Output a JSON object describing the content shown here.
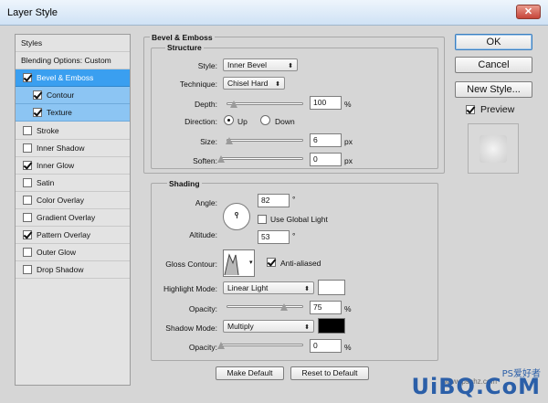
{
  "window": {
    "title": "Layer Style",
    "close_glyph": "✕"
  },
  "styles_list": [
    {
      "label": "Styles",
      "kind": "plain",
      "checked": null
    },
    {
      "label": "Blending Options: Custom",
      "kind": "plain",
      "checked": null
    },
    {
      "label": "Bevel & Emboss",
      "kind": "selected",
      "checked": true
    },
    {
      "label": "Contour",
      "kind": "sub",
      "checked": true
    },
    {
      "label": "Texture",
      "kind": "sub",
      "checked": true
    },
    {
      "label": "Stroke",
      "kind": "normal",
      "checked": false
    },
    {
      "label": "Inner Shadow",
      "kind": "normal",
      "checked": false
    },
    {
      "label": "Inner Glow",
      "kind": "normal",
      "checked": true
    },
    {
      "label": "Satin",
      "kind": "normal",
      "checked": false
    },
    {
      "label": "Color Overlay",
      "kind": "normal",
      "checked": false
    },
    {
      "label": "Gradient Overlay",
      "kind": "normal",
      "checked": false
    },
    {
      "label": "Pattern Overlay",
      "kind": "normal",
      "checked": true
    },
    {
      "label": "Outer Glow",
      "kind": "normal",
      "checked": false
    },
    {
      "label": "Drop Shadow",
      "kind": "normal",
      "checked": false
    }
  ],
  "bevel": {
    "section_title": "Bevel & Emboss",
    "structure_title": "Structure",
    "style_label": "Style:",
    "style_value": "Inner Bevel",
    "technique_label": "Technique:",
    "technique_value": "Chisel Hard",
    "depth_label": "Depth:",
    "depth_value": "100",
    "depth_unit": "%",
    "depth_level": 0.1,
    "direction_label": "Direction:",
    "dir_up": "Up",
    "dir_down": "Down",
    "direction_selected": "Up",
    "size_label": "Size:",
    "size_value": "6",
    "size_unit": "px",
    "size_level": 0.03,
    "soften_label": "Soften:",
    "soften_value": "0",
    "soften_unit": "px",
    "soften_level": 0.0
  },
  "shading": {
    "title": "Shading",
    "angle_label": "Angle:",
    "angle_value": "82",
    "angle_unit": "°",
    "global_light_label": "Use Global Light",
    "global_light_checked": false,
    "altitude_label": "Altitude:",
    "altitude_value": "53",
    "altitude_unit": "°",
    "gloss_label": "Gloss Contour:",
    "anti_aliased_label": "Anti-aliased",
    "anti_aliased_checked": true,
    "highlight_mode_label": "Highlight Mode:",
    "highlight_mode_value": "Linear Light",
    "highlight_color": "#ffffff",
    "highlight_opacity_label": "Opacity:",
    "highlight_opacity_value": "75",
    "highlight_opacity_unit": "%",
    "highlight_opacity_level": 0.75,
    "shadow_mode_label": "Shadow Mode:",
    "shadow_mode_value": "Multiply",
    "shadow_color": "#000000",
    "shadow_opacity_label": "Opacity:",
    "shadow_opacity_value": "0",
    "shadow_opacity_unit": "%",
    "shadow_opacity_level": 0.0
  },
  "footer": {
    "make_default": "Make Default",
    "reset_default": "Reset to Default"
  },
  "actions": {
    "ok": "OK",
    "cancel": "Cancel",
    "new_style": "New Style...",
    "preview_label": "Preview",
    "preview_checked": true
  },
  "watermark": {
    "brand": "UiBQ.CoM",
    "chars": "PS爱好者",
    "url": "www.psahz.com"
  },
  "colors": {
    "selected": "#3a9ff0",
    "sub_selected": "#8cc5f3",
    "titlebar": "#cfe2f5"
  }
}
